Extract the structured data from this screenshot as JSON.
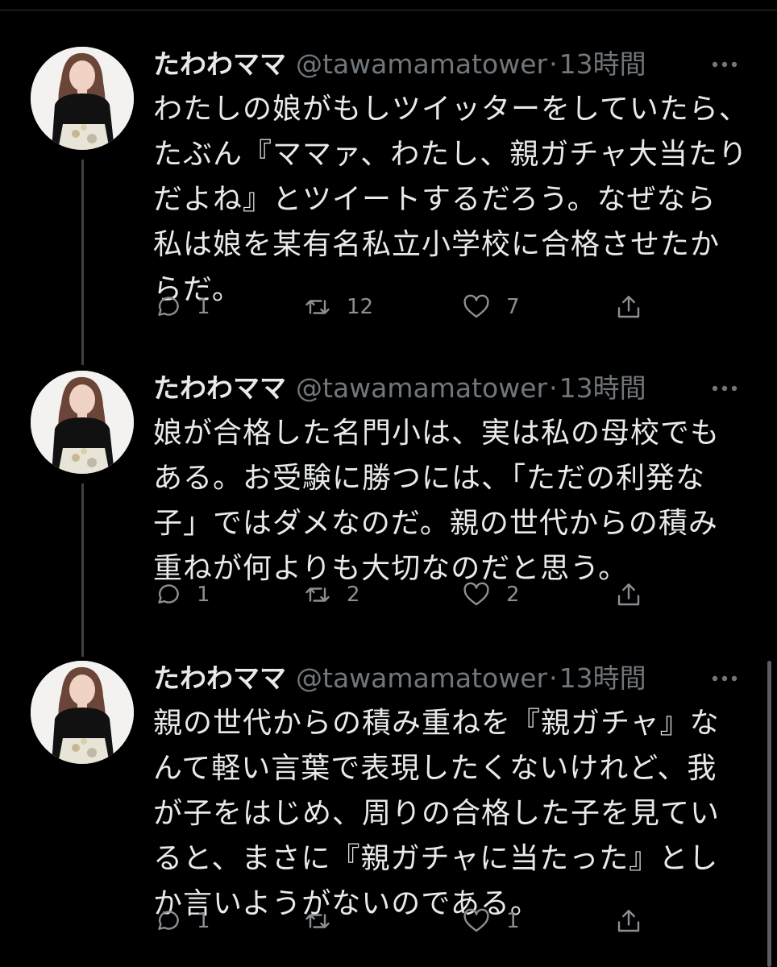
{
  "tweets": [
    {
      "display_name": "たわわママ",
      "handle": "@tawamamatower",
      "separator": "·",
      "time": "13時間",
      "text": "わたしの娘がもしツイッターをしていたら、\nたぶん『ママァ、わたし、親ガチャ大当たり\nだよね』とツイートするだろう。なぜなら\n私は娘を某有名私立小学校に合格させたか\nらだ。",
      "reply_count": "1",
      "retweet_count": "12",
      "like_count": "7"
    },
    {
      "display_name": "たわわママ",
      "handle": "@tawamamatower",
      "separator": "·",
      "time": "13時間",
      "text": "娘が合格した名門小は、実は私の母校でも\nある。お受験に勝つには、「ただの利発な\n子」ではダメなのだ。親の世代からの積み\n重ねが何よりも大切なのだと思う。",
      "reply_count": "1",
      "retweet_count": "2",
      "like_count": "2"
    },
    {
      "display_name": "たわわママ",
      "handle": "@tawamamatower",
      "separator": "·",
      "time": "13時間",
      "text": "親の世代からの積み重ねを『親ガチャ』な\nんて軽い言葉で表現したくないけれど、我\nが子をはじめ、周りの合格した子を見てい\nると、まさに『親ガチャに当たった』とし\nか言いようがないのである。",
      "reply_count": "1",
      "retweet_count": "",
      "like_count": "1"
    }
  ],
  "icons": {
    "reply": "reply-icon",
    "retweet": "retweet-icon",
    "like": "heart-icon",
    "share": "share-icon",
    "more": "more-icon",
    "avatar": "avatar"
  },
  "colors": {
    "background": "#000000",
    "text": "#e7e9ea",
    "secondary": "#71767b",
    "thread_line": "#3e4144"
  }
}
